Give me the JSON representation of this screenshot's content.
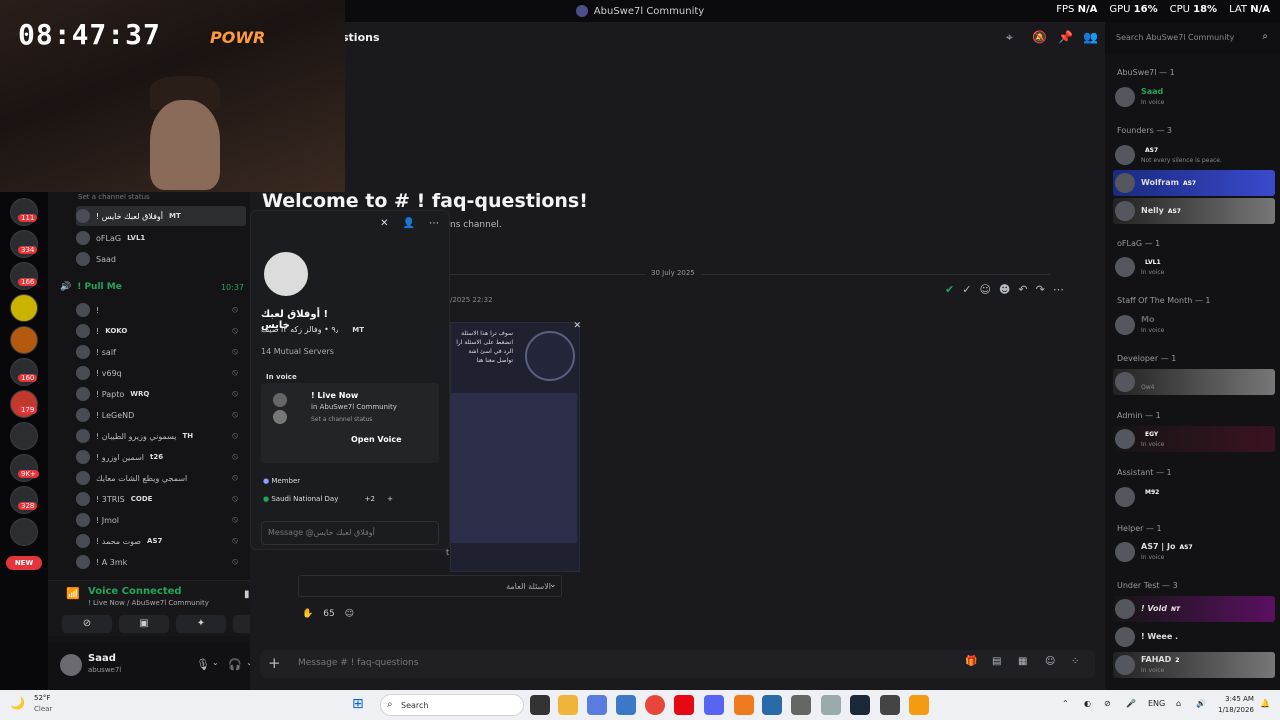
{
  "window": {
    "title": "AbuSwe7l Community"
  },
  "perf": {
    "fps_label": "FPS",
    "fps": "N/A",
    "gpu_label": "GPU",
    "gpu": "16%",
    "cpu_label": "CPU",
    "cpu": "18%",
    "lat_label": "LAT",
    "lat": "N/A"
  },
  "webcam": {
    "clock": "08:47:37",
    "neon": "POWR"
  },
  "rail": {
    "badges": [
      "111",
      "334",
      "166",
      "160",
      "179",
      "9K+",
      "328"
    ],
    "new": "NEW"
  },
  "channels": {
    "status_hint": "Set a channel status",
    "top_members": [
      {
        "name": "! أوفلاق لعبك خايس",
        "tag": "MT"
      },
      {
        "name": "oFLaG",
        "tag": "LVL1"
      },
      {
        "name": "Saad",
        "tag": ""
      }
    ],
    "voice_channel": {
      "name": "! Pull Me",
      "time": "10:37"
    },
    "voice_members": [
      {
        "name": "!",
        "tag": ""
      },
      {
        "name": "!",
        "tag": "KOKO"
      },
      {
        "name": "! saif",
        "tag": ""
      },
      {
        "name": "! v69q",
        "tag": ""
      },
      {
        "name": "! Papto",
        "tag": "WRQ"
      },
      {
        "name": "! LeGeND",
        "tag": ""
      },
      {
        "name": "! يسموني وزيرو الطيبان",
        "tag": "TH"
      },
      {
        "name": "! اسمين اوزرو",
        "tag": "t26"
      },
      {
        "name": "اسمجي ويطع الشات معايك",
        "tag": ""
      },
      {
        "name": "! 3TRIS",
        "tag": "CODE"
      },
      {
        "name": "! Jmol",
        "tag": ""
      },
      {
        "name": "! صوت محمد",
        "tag": "AS7"
      },
      {
        "name": "! A 3mk",
        "tag": ""
      }
    ]
  },
  "voice_connected": {
    "title": "Voice Connected",
    "sub": "! Live Now / AbuSwe7l Community"
  },
  "user": {
    "name": "Saad",
    "handle": "abuswe7l"
  },
  "main": {
    "channel_name": "faq-questions",
    "channel_name_partial": "stions",
    "search_placeholder": "Search AbuSwe7l Community",
    "welcome": "Welcome to # ! faq-questions!",
    "welcome_sub": "ns channel.",
    "date": "30 July 2025",
    "msg_time": "/2025 22:32",
    "card_text": "سوف ترا هذا الاسئلة انضغط على الاسئلة ارا الرد في اسئ اشة تواصل معنا هنا",
    "select_value": "الاسئلة العامة",
    "reaction_count": "65",
    "composer_placeholder": "Message # ! faq-questions",
    "trailing_char": "t"
  },
  "popout": {
    "name": "! أوفلاق لعبك خايس",
    "bio": "٩٫ • وفالز زكه ٢ا صيف",
    "bio_tag": "MT",
    "mutual": "14 Mutual Servers",
    "in_voice_label": "In voice",
    "live_now": "! Live Now",
    "in_server": "in AbuSwe7l Community",
    "channel_status": "Set a channel status",
    "open_voice": "Open Voice",
    "role_member": "Member",
    "role_national": "Saudi National Day",
    "extra_roles": "+2",
    "message_placeholder": "Message @أوفلاق لعبك خايس"
  },
  "members": {
    "groups": [
      {
        "title": "AbuSwe7l — 1"
      },
      {
        "title": "Founders — 3"
      },
      {
        "title": "oFLaG — 1"
      },
      {
        "title": "Staff Of The Month — 1"
      },
      {
        "title": "Developer — 1"
      },
      {
        "title": "Admin — 1"
      },
      {
        "title": "Assistant — 1"
      },
      {
        "title": "Helper — 1"
      },
      {
        "title": "Under Test — 3"
      }
    ],
    "list": [
      {
        "name": "Saad",
        "sub": "In voice",
        "tag": ""
      },
      {
        "name": "",
        "sub": "Not every silence is peace.",
        "tag": "AS7"
      },
      {
        "name": "Wolfram",
        "sub": "",
        "tag": "AS7"
      },
      {
        "name": "Nelly",
        "sub": "",
        "tag": "AS7"
      },
      {
        "name": "",
        "sub": "In voice",
        "tag": "LVL1"
      },
      {
        "name": "Mo",
        "sub": "In voice",
        "tag": ""
      },
      {
        "name": "",
        "sub": "Ow4",
        "tag": ""
      },
      {
        "name": "",
        "sub": "In voice",
        "tag": "EGY"
      },
      {
        "name": "",
        "sub": "",
        "tag": "M92"
      },
      {
        "name": "AS7 | Jo",
        "sub": "In voice",
        "tag": "AS7"
      },
      {
        "name": "! Vold",
        "sub": "",
        "tag": "NT"
      },
      {
        "name": "! Weee .",
        "sub": "",
        "tag": ""
      },
      {
        "name": "FAHAD",
        "sub": "In voice",
        "tag": "2"
      }
    ]
  },
  "taskbar": {
    "temp": "52°F",
    "cond": "Clear",
    "search": "Search",
    "lang": "ENG",
    "time": "3:45 AM",
    "date": "1/18/2026"
  }
}
